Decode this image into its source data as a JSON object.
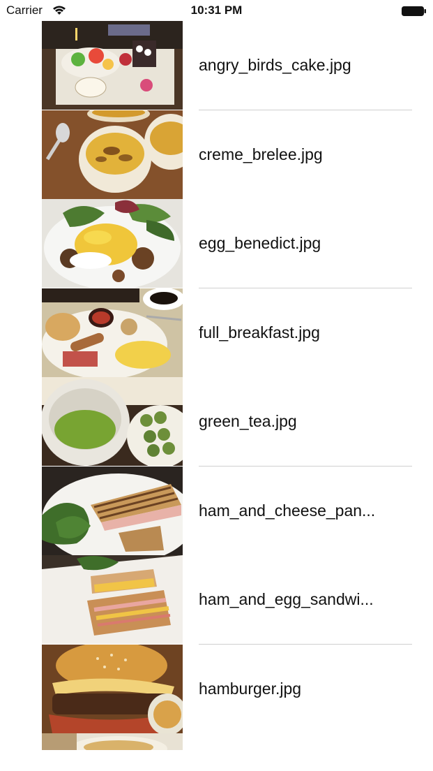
{
  "status_bar": {
    "carrier": "Carrier",
    "time": "10:31 PM",
    "wifi_icon": "wifi-icon",
    "battery_icon": "battery-full-icon"
  },
  "photos": [
    {
      "label": "angry_birds_cake.jpg"
    },
    {
      "label": "creme_brelee.jpg"
    },
    {
      "label": "egg_benedict.jpg"
    },
    {
      "label": "full_breakfast.jpg"
    },
    {
      "label": "green_tea.jpg"
    },
    {
      "label": "ham_and_cheese_pan..."
    },
    {
      "label": "ham_and_egg_sandwi..."
    },
    {
      "label": "hamburger.jpg"
    }
  ]
}
